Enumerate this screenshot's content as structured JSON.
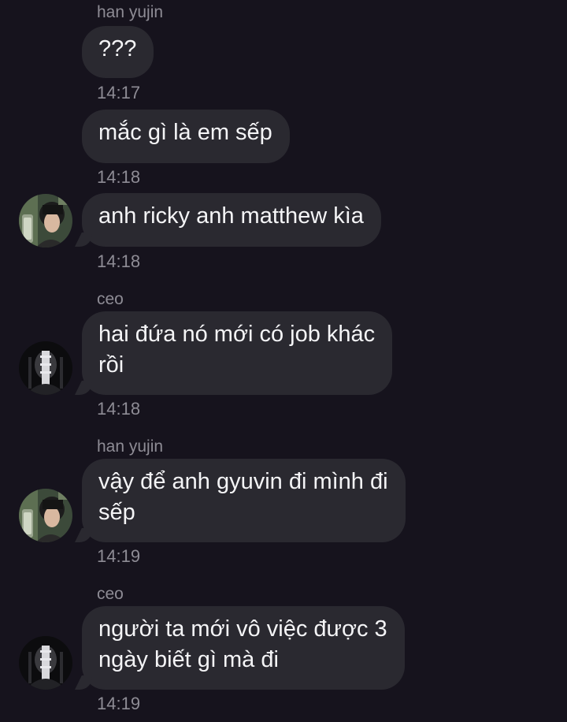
{
  "chat": {
    "messages": [
      {
        "sender": "han yujin",
        "text": "???",
        "time": "14:17"
      },
      {
        "text": "mắc gì là em sếp",
        "time": "14:18"
      },
      {
        "text": "anh ricky anh matthew kìa",
        "time": "14:18",
        "avatar": "han-yujin-avatar"
      },
      {
        "sender": "ceo",
        "text": "hai đứa nó mới có job khác\nrồi",
        "time": "14:18",
        "avatar": "ceo-avatar"
      },
      {
        "sender": "han yujin",
        "text": "vậy để anh gyuvin đi mình đi\nsếp",
        "time": "14:19",
        "avatar": "han-yujin-avatar"
      },
      {
        "sender": "ceo",
        "text": "người ta mới vô việc được 3\nngày biết gì mà đi",
        "time": "14:19",
        "avatar": "ceo-avatar"
      }
    ]
  },
  "colors": {
    "background": "#16131d",
    "bubble": "#2a2930",
    "text": "#f4f4f6",
    "meta_text": "#8e8c95"
  }
}
